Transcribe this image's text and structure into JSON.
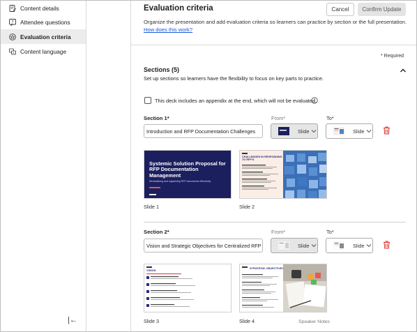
{
  "sidebar": {
    "items": [
      {
        "label": "Content details",
        "icon": "document-edit-icon"
      },
      {
        "label": "Attendee questions",
        "icon": "question-box-icon"
      },
      {
        "label": "Evaluation criteria",
        "icon": "badge-star-icon",
        "active": true
      },
      {
        "label": "Content language",
        "icon": "language-icon"
      }
    ],
    "collapse_glyph": "|←"
  },
  "header": {
    "title": "Evaluation criteria",
    "description": "Organize the presentation and add evaluation criteria so learners can practice by section or the full presentation.",
    "link": "How does this work?",
    "cancel_label": "Cancel",
    "confirm_label": "Confirm Update"
  },
  "required_note": "* Required",
  "sections": {
    "title": "Sections (5)",
    "description": "Set up sections so learners have the flexibility to focus on key parts to practice.",
    "appendix_checkbox": {
      "label": "This deck includes an appendix at the end, which will not be evaluated.",
      "checked": false
    }
  },
  "section_list": [
    {
      "label": "Section 1*",
      "name_value": "Introduction and RFP Documentation Challenges",
      "from_label": "From*",
      "to_label": "To*",
      "from_value": "Slide",
      "to_value": "Slide",
      "slides": [
        {
          "caption": "Slide 1",
          "title": "Systemic Solution Proposal for RFP Documentation Management",
          "subtitle": "Streamlining and organizing RFP documents effectively"
        },
        {
          "caption": "Slide 2",
          "title": "CHALLENGES IN RESPONDING TO RFP'S"
        }
      ]
    },
    {
      "label": "Section 2*",
      "name_value": "Vision and Strategic Objectives for Centralized RFP M",
      "from_label": "From*",
      "to_label": "To*",
      "from_value": "Slide",
      "to_value": "Slide",
      "slides": [
        {
          "caption": "Slide 3",
          "title": "VISION"
        },
        {
          "caption": "Slide 4",
          "title": "STRATEGIC OBJECTIVES"
        }
      ]
    }
  ],
  "speaker_notes": "Speaker Notes",
  "colors": {
    "accent_link": "#1a56d6",
    "trash": "#d93025",
    "slide_dark": "#1b1f5e"
  }
}
